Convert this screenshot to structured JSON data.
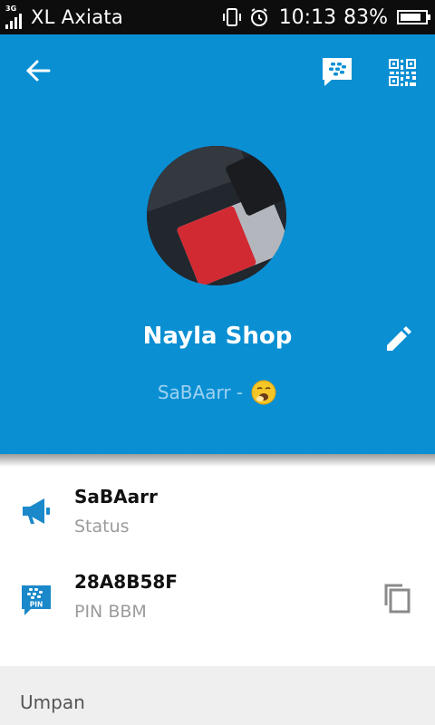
{
  "statusbar": {
    "network": "3G",
    "carrier": "XL Axiata",
    "time": "10:13",
    "battery": "83%",
    "battery_level": 0.83
  },
  "header": {
    "icons": [
      "arrow-left-icon",
      "bbm-chat-icon",
      "qr-code-icon"
    ],
    "name": "Nayla Shop",
    "status_text": "SaBAarr -",
    "edit_icon": "pencil-icon",
    "background": "#0a8fd3"
  },
  "profile": {
    "status": {
      "value": "SaBAarr",
      "label": "Status",
      "icon": "megaphone-icon"
    },
    "pin": {
      "value": "28A8B58F",
      "label": "PIN BBM",
      "icon_label": "PIN",
      "icon": "bbm-pin-icon",
      "action_icon": "copy-icon"
    }
  },
  "feed": {
    "label": "Umpan"
  },
  "colors": {
    "accent": "#0a8fd3",
    "icon": "#1a88c9"
  }
}
